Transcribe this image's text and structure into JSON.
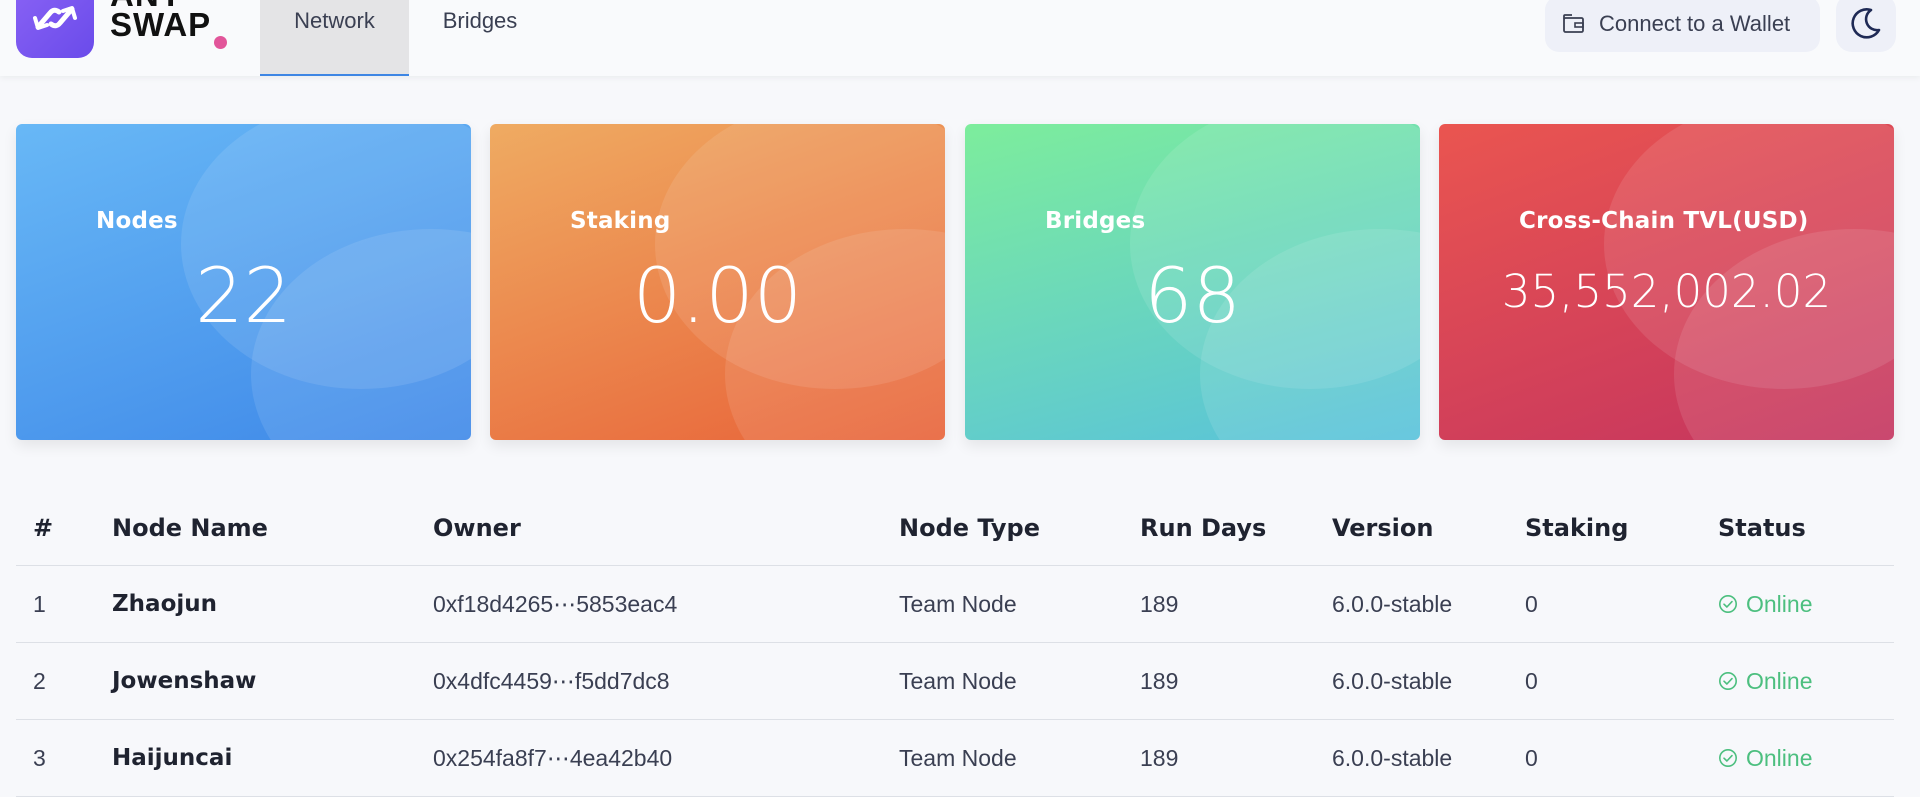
{
  "brand": {
    "logo_line1": "ANY",
    "logo_line2": "SWAP",
    "accent_color": "#7b58ef",
    "dot_color": "#e2559a"
  },
  "nav": {
    "tabs": [
      {
        "label": "Network",
        "active": true
      },
      {
        "label": "Bridges",
        "active": false
      }
    ],
    "wallet_label": "Connect to a Wallet",
    "wallet_icon": "wallet-icon",
    "theme_icon": "moon-icon"
  },
  "stats": [
    {
      "label": "Nodes",
      "value": "22",
      "color_start": "#68b8f6",
      "color_end": "#3e88e8"
    },
    {
      "label": "Staking",
      "value": "0.00",
      "color_start": "#efab62",
      "color_end": "#e86238"
    },
    {
      "label": "Bridges",
      "value": "68",
      "color_start": "#7ded9c",
      "color_end": "#58c1dc"
    },
    {
      "label": "Cross-Chain TVL(USD)",
      "value": "35,552,002.02",
      "color_start": "#ea5550",
      "color_end": "#c4345f"
    }
  ],
  "table": {
    "headers": [
      "#",
      "Node Name",
      "Owner",
      "Node Type",
      "Run Days",
      "Version",
      "Staking",
      "Status"
    ],
    "rows": [
      {
        "idx": "1",
        "name": "Zhaojun",
        "owner": "0xf18d4265⋯5853eac4",
        "type": "Team Node",
        "days": "189",
        "version": "6.0.0-stable",
        "staking": "0",
        "status": "Online"
      },
      {
        "idx": "2",
        "name": "Jowenshaw",
        "owner": "0x4dfc4459⋯f5dd7dc8",
        "type": "Team Node",
        "days": "189",
        "version": "6.0.0-stable",
        "staking": "0",
        "status": "Online"
      },
      {
        "idx": "3",
        "name": "Haijuncai",
        "owner": "0x254fa8f7⋯4ea42b40",
        "type": "Team Node",
        "days": "189",
        "version": "6.0.0-stable",
        "staking": "0",
        "status": "Online"
      }
    ],
    "status_color": "#4cbf7f",
    "status_icon": "check-circle-icon"
  }
}
